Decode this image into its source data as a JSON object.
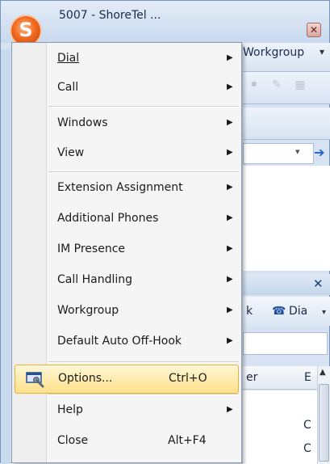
{
  "window": {
    "title": "5007 - ShoreTel ...",
    "close_glyph": "✕",
    "logo_glyph": "S"
  },
  "background": {
    "workgroup_label": "Workgroup",
    "dropdown_glyph": "▾",
    "go_glyph": "➔",
    "pane_close_glyph": "✕",
    "toolbar_partial_label": "k",
    "dial_label": "Dia",
    "dial_icon_glyph": "☎",
    "more_glyph": "▾",
    "column_partial_label": "er",
    "column_e_label": "E",
    "list_cells": [
      "C",
      "C"
    ],
    "scroll_up_glyph": "▲",
    "tool_icons_glyph": "⚫ ✎ ▦"
  },
  "menu": {
    "submenu_arrow": "▶",
    "items": [
      {
        "label": "Dial",
        "has_submenu": true
      },
      {
        "label": "Call",
        "has_submenu": true
      },
      {
        "label": "Windows",
        "has_submenu": true
      },
      {
        "label": "View",
        "has_submenu": true
      },
      {
        "label": "Extension Assignment",
        "has_submenu": true
      },
      {
        "label": "Additional Phones",
        "has_submenu": true
      },
      {
        "label": "IM Presence",
        "has_submenu": true
      },
      {
        "label": "Call Handling",
        "has_submenu": true
      },
      {
        "label": "Workgroup",
        "has_submenu": true
      },
      {
        "label": "Default Auto Off-Hook",
        "has_submenu": true
      },
      {
        "label": "Options...",
        "shortcut": "Ctrl+O",
        "highlighted": true,
        "icon": "options-icon"
      },
      {
        "label": "Help",
        "has_submenu": true
      },
      {
        "label": "Close",
        "shortcut": "Alt+F4"
      }
    ]
  },
  "colors": {
    "highlight": "#ffe08a",
    "logo": "#f26a21"
  }
}
